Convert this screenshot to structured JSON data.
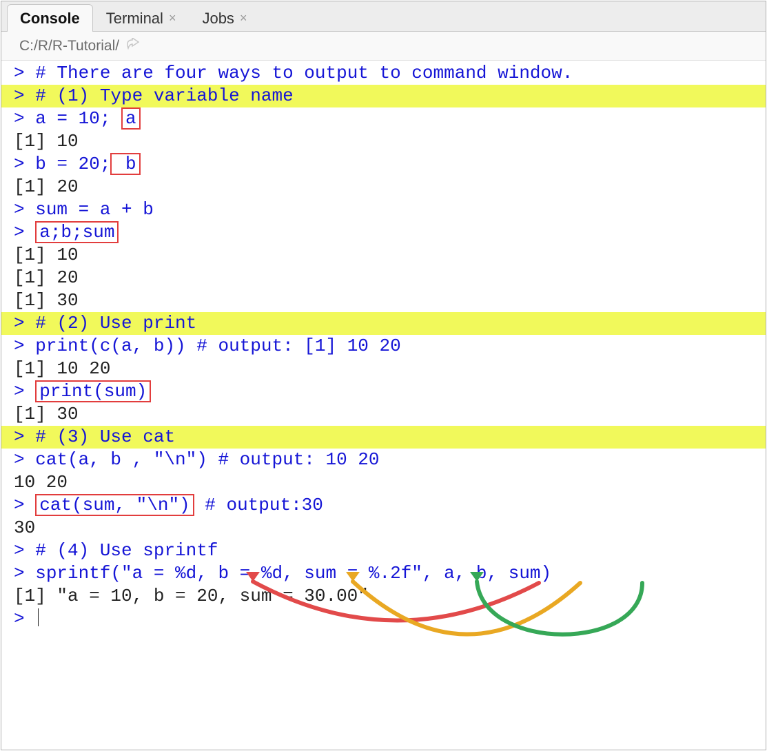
{
  "tabs": [
    {
      "label": "Console",
      "active": true,
      "closable": false
    },
    {
      "label": "Terminal",
      "active": false,
      "closable": true
    },
    {
      "label": "Jobs",
      "active": false,
      "closable": true
    }
  ],
  "workdir": "C:/R/R-Tutorial/",
  "lines": [
    {
      "kind": "in",
      "pre": "> ",
      "text": "# There are four ways to output to command window."
    },
    {
      "kind": "in",
      "pre": "> ",
      "text": "# (1) Type variable name",
      "hl": true
    },
    {
      "kind": "in",
      "pre": "> ",
      "segs": [
        {
          "t": "a = 10; "
        },
        {
          "t": "a",
          "box": true
        }
      ]
    },
    {
      "kind": "out",
      "text": "[1] 10"
    },
    {
      "kind": "in",
      "pre": "> ",
      "segs": [
        {
          "t": "b = 20;"
        },
        {
          "t": " b",
          "box": true
        }
      ]
    },
    {
      "kind": "out",
      "text": "[1] 20"
    },
    {
      "kind": "in",
      "pre": "> ",
      "text": "sum = a + b"
    },
    {
      "kind": "in",
      "pre": "> ",
      "segs": [
        {
          "t": "a;b;sum",
          "box": true
        }
      ]
    },
    {
      "kind": "out",
      "text": "[1] 10"
    },
    {
      "kind": "out",
      "text": "[1] 20"
    },
    {
      "kind": "out",
      "text": "[1] 30"
    },
    {
      "kind": "in",
      "pre": "> ",
      "text": "# (2) Use print",
      "hl": true
    },
    {
      "kind": "in",
      "pre": "> ",
      "text": "print(c(a, b)) # output: [1] 10 20"
    },
    {
      "kind": "out",
      "text": "[1] 10 20"
    },
    {
      "kind": "in",
      "pre": "> ",
      "segs": [
        {
          "t": "print(sum)",
          "box": true
        }
      ]
    },
    {
      "kind": "out",
      "text": "[1] 30"
    },
    {
      "kind": "in",
      "pre": "> ",
      "text": "# (3) Use cat",
      "hl": true
    },
    {
      "kind": "in",
      "pre": "> ",
      "text": "cat(a, b , \"\\n\") # output: 10 20"
    },
    {
      "kind": "out",
      "text": "10 20"
    },
    {
      "kind": "in",
      "pre": "> ",
      "segs": [
        {
          "t": "cat(sum, \"\\n\")",
          "box": true
        },
        {
          "t": " # output:30"
        }
      ]
    },
    {
      "kind": "out",
      "text": "30"
    },
    {
      "kind": "in",
      "pre": "> ",
      "text": "# (4) Use sprintf"
    },
    {
      "kind": "in",
      "pre": "> ",
      "text": "sprintf(\"a = %d, b = %d, sum = %.2f\", a, b, sum)"
    },
    {
      "kind": "out",
      "text": "[1] \"a = 10, b = 20, sum = 30.00\""
    },
    {
      "kind": "in",
      "pre": "> ",
      "text": "",
      "prompt_cursor": true
    }
  ],
  "annotations": {
    "arrows": [
      {
        "name": "arrow-a",
        "color": "#e24a4a",
        "from": "a",
        "to": "%d-1"
      },
      {
        "name": "arrow-b",
        "color": "#e9a823",
        "from": "b",
        "to": "%d-2"
      },
      {
        "name": "arrow-sum",
        "color": "#36a857",
        "from": "sum",
        "to": "%.2f"
      }
    ]
  }
}
